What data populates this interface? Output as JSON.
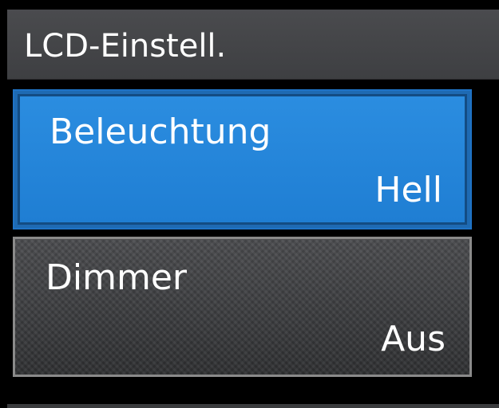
{
  "header": {
    "title": "LCD-Einstell."
  },
  "menu": {
    "items": [
      {
        "label": "Beleuchtung",
        "value": "Hell",
        "selected": true
      },
      {
        "label": "Dimmer",
        "value": "Aus",
        "selected": false
      }
    ]
  },
  "colors": {
    "selected_background": "#2b8de0",
    "title_bar_background": "#4a4b4e",
    "screen_background": "#000000"
  }
}
